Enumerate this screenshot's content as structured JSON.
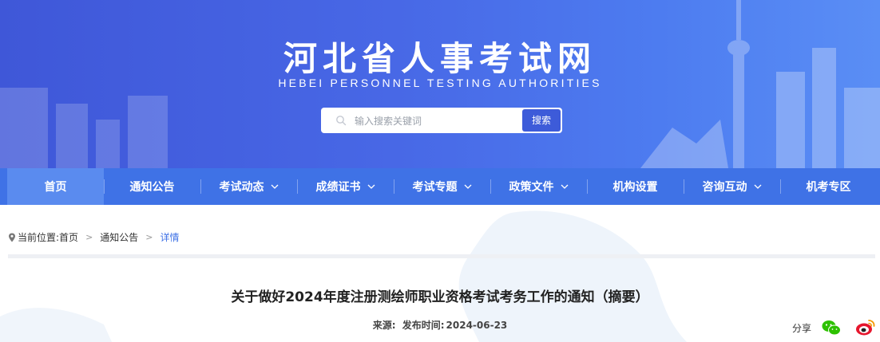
{
  "header": {
    "site_title": "河北省人事考试网",
    "site_subtitle": "HEBEI PERSONNEL TESTING AUTHORITIES"
  },
  "search": {
    "placeholder": "输入搜索关键词",
    "button_label": "搜索"
  },
  "nav": {
    "items": [
      {
        "label": "首页",
        "dropdown": false,
        "active": true
      },
      {
        "label": "通知公告",
        "dropdown": false,
        "active": false
      },
      {
        "label": "考试动态",
        "dropdown": true,
        "active": false
      },
      {
        "label": "成绩证书",
        "dropdown": true,
        "active": false
      },
      {
        "label": "考试专题",
        "dropdown": true,
        "active": false
      },
      {
        "label": "政策文件",
        "dropdown": true,
        "active": false
      },
      {
        "label": "机构设置",
        "dropdown": false,
        "active": false
      },
      {
        "label": "咨询互动",
        "dropdown": true,
        "active": false
      },
      {
        "label": "机考专区",
        "dropdown": false,
        "active": false
      }
    ]
  },
  "breadcrumb": {
    "prefix": "当前位置:",
    "items": [
      "首页",
      "通知公告",
      "详情"
    ],
    "separator": ">"
  },
  "article": {
    "title": "关于做好2024年度注册测绘师职业资格考试考务工作的通知（摘要）",
    "source_label": "来源:",
    "publish_label": "发布时间:",
    "publish_date": "2024-06-23"
  },
  "share": {
    "label": "分享",
    "icons": [
      "wechat-icon",
      "weibo-icon"
    ]
  },
  "colors": {
    "header_blue": "#4868e6",
    "nav_blue": "#3f72e6",
    "nav_active": "#5a8bef",
    "wechat_green": "#2dc100",
    "weibo_red": "#e6162d"
  }
}
